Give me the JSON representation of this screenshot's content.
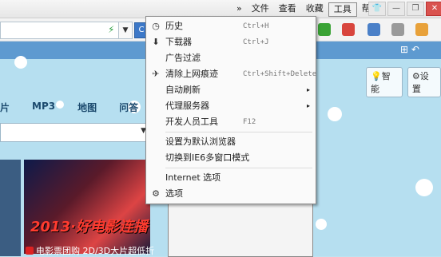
{
  "menubar": {
    "items": [
      "文件",
      "查看",
      "收藏",
      "工具",
      "帮助"
    ],
    "chevron": "»"
  },
  "window": {
    "min": "—",
    "restore": "❐",
    "close": "✕"
  },
  "toolbar": {
    "search_label": "C"
  },
  "content": {
    "smart_label": "智能",
    "settings_label": "设置",
    "nav": [
      "片",
      "MP3",
      "地图",
      "问答"
    ],
    "poster_text": "2013·好电影连播",
    "caption": "电影票团购 2D/3D大片超低折"
  },
  "tools_menu": {
    "items": [
      {
        "label": "历史",
        "shortcut": "Ctrl+H",
        "icon": "history-icon",
        "glyph": "◷"
      },
      {
        "label": "下载器",
        "shortcut": "Ctrl+J",
        "icon": "download-icon",
        "glyph": "⬇"
      },
      {
        "label": "广告过滤",
        "shortcut": "",
        "icon": "",
        "glyph": ""
      },
      {
        "label": "清除上网痕迹",
        "shortcut": "Ctrl+Shift+Delete",
        "icon": "clear-trace-icon",
        "glyph": "✈"
      },
      {
        "label": "自动刷新",
        "shortcut": "",
        "icon": "",
        "glyph": "",
        "submenu": true
      },
      {
        "label": "代理服务器",
        "shortcut": "",
        "icon": "",
        "glyph": "",
        "submenu": true
      },
      {
        "label": "开发人员工具",
        "shortcut": "F12",
        "icon": "",
        "glyph": ""
      },
      {
        "label": "设置为默认浏览器",
        "shortcut": "",
        "icon": "",
        "glyph": ""
      },
      {
        "label": "切换到IE6多窗口模式",
        "shortcut": "",
        "icon": "",
        "glyph": ""
      },
      {
        "label": "Internet 选项",
        "shortcut": "",
        "icon": "",
        "glyph": ""
      },
      {
        "label": "选项",
        "shortcut": "",
        "icon": "gear-icon",
        "glyph": "⚙"
      }
    ],
    "submenu_arrow": "▸"
  },
  "colors": {
    "accent": "#5e9ad0",
    "background": "#b6dff0"
  }
}
